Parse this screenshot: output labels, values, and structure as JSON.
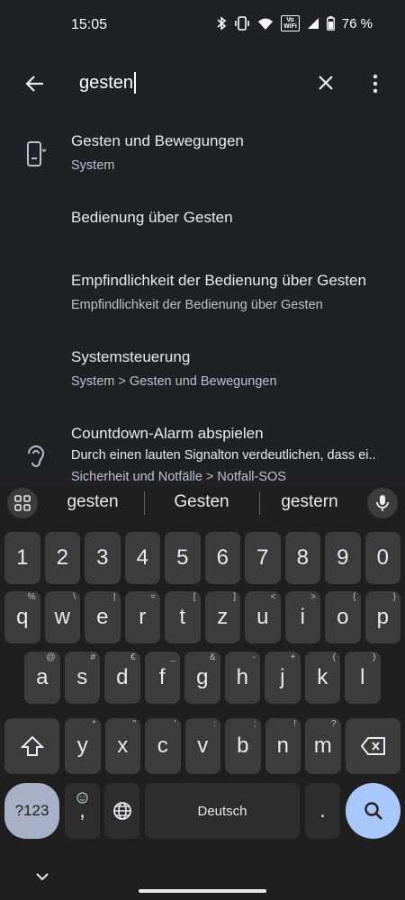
{
  "status_bar": {
    "time": "15:05",
    "vowifi": [
      "Vo",
      "WiFi"
    ],
    "battery_text": "76 %",
    "icons": [
      "bluetooth-icon",
      "vibrate-icon",
      "wifi-icon",
      "vowifi-icon",
      "signal-icon",
      "battery-icon"
    ]
  },
  "search": {
    "query": "gesten",
    "icons": [
      "back-arrow-icon",
      "clear-icon",
      "more-vert-icon"
    ]
  },
  "results": [
    {
      "title": "Gesten und Bewegungen",
      "subtitle": "System",
      "icon": "phone-gesture-icon"
    },
    {
      "title": "Bedienung über Gesten",
      "subtitle": "",
      "icon": ""
    },
    {
      "title": "Empfindlichkeit der Bedienung über Gesten",
      "subtitle": "Empfindlichkeit der Bedienung über Gesten",
      "icon": ""
    },
    {
      "title": "Systemsteuerung",
      "subtitle": "System > Gesten und Bewegungen",
      "icon": ""
    },
    {
      "title": "Countdown-Alarm abspielen",
      "subtitle": "Durch einen lauten Signalton verdeutlichen, dass ei..",
      "subtitle2": "Sicherheit und Notfälle > Notfall-SOS",
      "icon": "hearing-icon"
    }
  ],
  "keyboard": {
    "suggestions": [
      "gesten",
      "Gesten",
      "gestern"
    ],
    "number_row": [
      "1",
      "2",
      "3",
      "4",
      "5",
      "6",
      "7",
      "8",
      "9",
      "0"
    ],
    "row1": [
      {
        "k": "q",
        "h": "%"
      },
      {
        "k": "w",
        "h": "\\"
      },
      {
        "k": "e",
        "h": "|"
      },
      {
        "k": "r",
        "h": "="
      },
      {
        "k": "t",
        "h": "["
      },
      {
        "k": "z",
        "h": "]"
      },
      {
        "k": "u",
        "h": "<"
      },
      {
        "k": "i",
        "h": ">"
      },
      {
        "k": "o",
        "h": "{"
      },
      {
        "k": "p",
        "h": "}"
      }
    ],
    "row2": [
      {
        "k": "a",
        "h": "@"
      },
      {
        "k": "s",
        "h": "#"
      },
      {
        "k": "d",
        "h": "€"
      },
      {
        "k": "f",
        "h": "_"
      },
      {
        "k": "g",
        "h": "&"
      },
      {
        "k": "h",
        "h": "-"
      },
      {
        "k": "j",
        "h": "+"
      },
      {
        "k": "k",
        "h": "("
      },
      {
        "k": "l",
        "h": ")"
      }
    ],
    "row3": [
      {
        "k": "y",
        "h": "*"
      },
      {
        "k": "x",
        "h": "\""
      },
      {
        "k": "c",
        "h": "'"
      },
      {
        "k": "v",
        "h": ":"
      },
      {
        "k": "b",
        "h": ";"
      },
      {
        "k": "n",
        "h": "!"
      },
      {
        "k": "m",
        "h": "?"
      }
    ],
    "symbols_label": "?123",
    "comma": ",",
    "space_label": "Deutsch",
    "period": ".",
    "accent_color": "#a8c7fa"
  }
}
